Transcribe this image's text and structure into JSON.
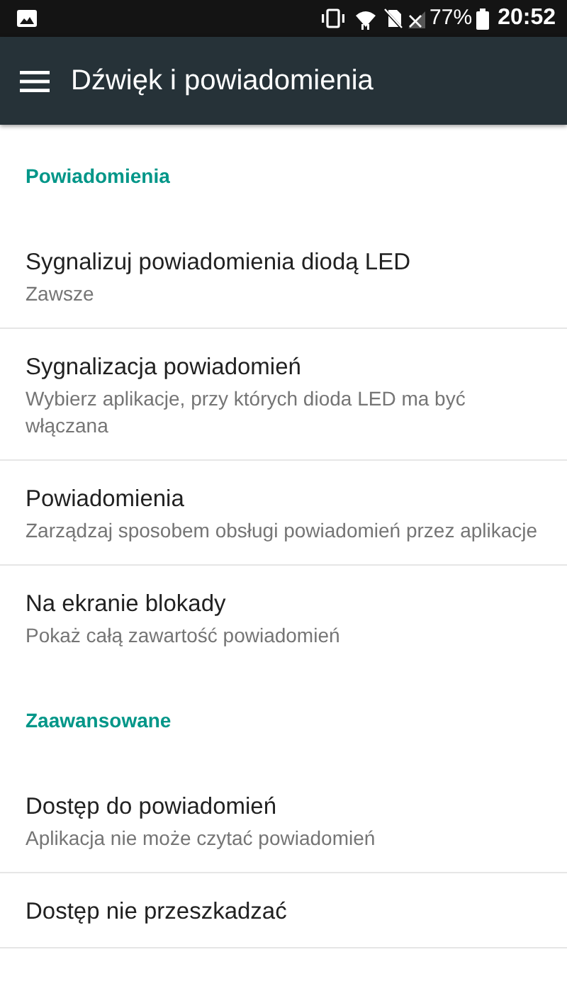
{
  "status_bar": {
    "battery": "77%",
    "time": "20:52"
  },
  "app_bar": {
    "title": "Dźwięk i powiadomienia"
  },
  "sections": [
    {
      "header": "Powiadomienia",
      "items": [
        {
          "title": "Sygnalizuj powiadomienia diodą LED",
          "summary": "Zawsze"
        },
        {
          "title": "Sygnalizacja powiadomień",
          "summary": "Wybierz aplikacje, przy których dioda LED ma być włączana"
        },
        {
          "title": "Powiadomienia",
          "summary": "Zarządzaj sposobem obsługi powiadomień przez aplikacje"
        },
        {
          "title": "Na ekranie blokady",
          "summary": "Pokaż całą zawartość powiadomień"
        }
      ]
    },
    {
      "header": "Zaawansowane",
      "items": [
        {
          "title": "Dostęp do powiadomień",
          "summary": "Aplikacja nie może czytać powiadomień"
        },
        {
          "title": "Dostęp nie przeszkadzać"
        }
      ]
    }
  ]
}
